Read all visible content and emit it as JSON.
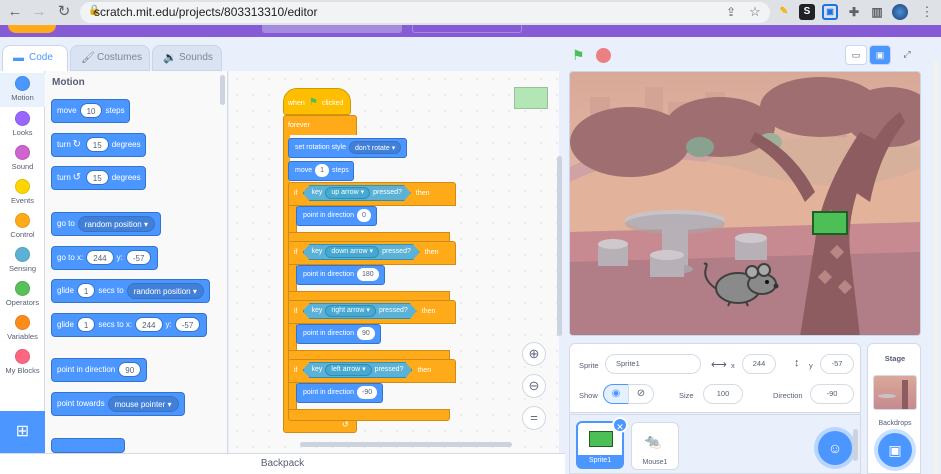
{
  "browser": {
    "url": "scratch.mit.edu/projects/803313310/editor",
    "ext_s": "S"
  },
  "tabs": [
    {
      "label": "Code"
    },
    {
      "label": "Costumes"
    },
    {
      "label": "Sounds"
    }
  ],
  "categories": [
    {
      "label": "Motion",
      "color": "#4c97ff"
    },
    {
      "label": "Looks",
      "color": "#9966ff"
    },
    {
      "label": "Sound",
      "color": "#cf63cf"
    },
    {
      "label": "Events",
      "color": "#ffd500"
    },
    {
      "label": "Control",
      "color": "#ffab19"
    },
    {
      "label": "Sensing",
      "color": "#5cb1d6"
    },
    {
      "label": "Operators",
      "color": "#59c059"
    },
    {
      "label": "Variables",
      "color": "#ff8c1a"
    },
    {
      "label": "My Blocks",
      "color": "#ff6680"
    }
  ],
  "palette": {
    "heading": "Motion",
    "move": {
      "a": "move",
      "v": "10",
      "b": "steps"
    },
    "turn_cw": {
      "a": "turn",
      "v": "15",
      "b": "degrees"
    },
    "turn_ccw": {
      "a": "turn",
      "v": "15",
      "b": "degrees"
    },
    "goto": {
      "a": "go to",
      "d": "random position"
    },
    "gotoxy": {
      "a": "go to x:",
      "x": "244",
      "yl": "y:",
      "y": "-57"
    },
    "glide1": {
      "a": "glide",
      "v": "1",
      "b": "secs to",
      "d": "random position"
    },
    "glide2": {
      "a": "glide",
      "v": "1",
      "b": "secs to x:",
      "x": "244",
      "yl": "y:",
      "y": "-57"
    },
    "point_dir": {
      "a": "point in direction",
      "v": "90"
    },
    "point_towards": {
      "a": "point towards",
      "d": "mouse pointer"
    }
  },
  "script": {
    "hat": "when",
    "hat_b": "clicked",
    "forever": "forever",
    "rot_style": {
      "a": "set rotation style",
      "d": "don't rotate"
    },
    "move": {
      "a": "move",
      "v": "1",
      "b": "steps"
    },
    "ifs": [
      {
        "if": "if",
        "key": "key",
        "k": "up arrow",
        "pressed": "pressed?",
        "then": "then",
        "point": "point in direction",
        "dir": "0"
      },
      {
        "if": "if",
        "key": "key",
        "k": "down arrow",
        "pressed": "pressed?",
        "then": "then",
        "point": "point in direction",
        "dir": "180"
      },
      {
        "if": "if",
        "key": "key",
        "k": "right arrow",
        "pressed": "pressed?",
        "then": "then",
        "point": "point in direction",
        "dir": "90"
      },
      {
        "if": "if",
        "key": "key",
        "k": "left arrow",
        "pressed": "pressed?",
        "then": "then",
        "point": "point in direction",
        "dir": "-90"
      }
    ]
  },
  "zoom": {
    "in": "+",
    "out": "−",
    "reset": "="
  },
  "backpack": "Backpack",
  "sprite_info": {
    "sprite_label": "Sprite",
    "sprite_name": "Sprite1",
    "x_label": "x",
    "x": "244",
    "y_label": "y",
    "y": "-57",
    "show_label": "Show",
    "size_label": "Size",
    "size": "100",
    "direction_label": "Direction",
    "direction": "-90"
  },
  "sprites": [
    {
      "name": "Sprite1"
    },
    {
      "name": "Mouse1"
    }
  ],
  "stage_panel": {
    "title": "Stage",
    "backdrops_label": "Backdrops"
  },
  "colors": {
    "motion": "#4c97ff",
    "control": "#ffab19",
    "sensing": "#5cb1d6",
    "menu": "#855cd6"
  }
}
